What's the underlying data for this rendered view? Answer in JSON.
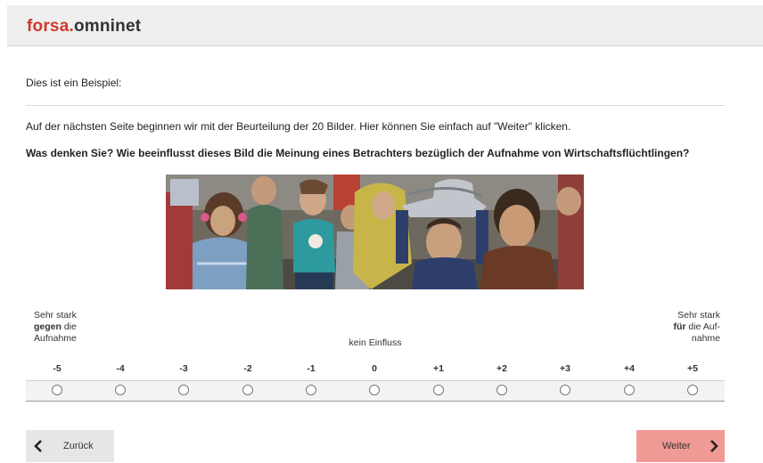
{
  "header": {
    "logo_part1": "forsa.",
    "logo_part2": "omninet"
  },
  "intro_text": "Dies ist ein Beispiel:",
  "instruction_text": "Auf der nächsten Seite beginnen wir mit der Beurteilung der 20 Bilder. Hier können Sie einfach auf \"Weiter\" klicken.",
  "question_text": "Was denken Sie? Wie beeinflusst dieses Bild die Meinung eines Betrachters bezüglich der Aufnahme von Wirtschaftsflüchtlingen?",
  "scale": {
    "left_label": {
      "line1": "Sehr stark",
      "bold": "gegen",
      "rest": " die",
      "line3": "Aufnahme"
    },
    "center_label": "kein Einfluss",
    "right_label": {
      "line1": "Sehr stark",
      "bold": "für",
      "rest": " die Auf-",
      "line3": "nahme"
    },
    "values": [
      "-5",
      "-4",
      "-3",
      "-2",
      "-1",
      "0",
      "+1",
      "+2",
      "+3",
      "+4",
      "+5"
    ],
    "selected": null
  },
  "buttons": {
    "back_label": "Zurück",
    "next_label": "Weiter"
  },
  "icons": {
    "back": "chevron-left-icon",
    "next": "chevron-right-icon"
  },
  "colors": {
    "brand_red": "#cf3a2b",
    "next_button_bg": "#f09a95",
    "back_button_bg": "#e6e6e6"
  }
}
